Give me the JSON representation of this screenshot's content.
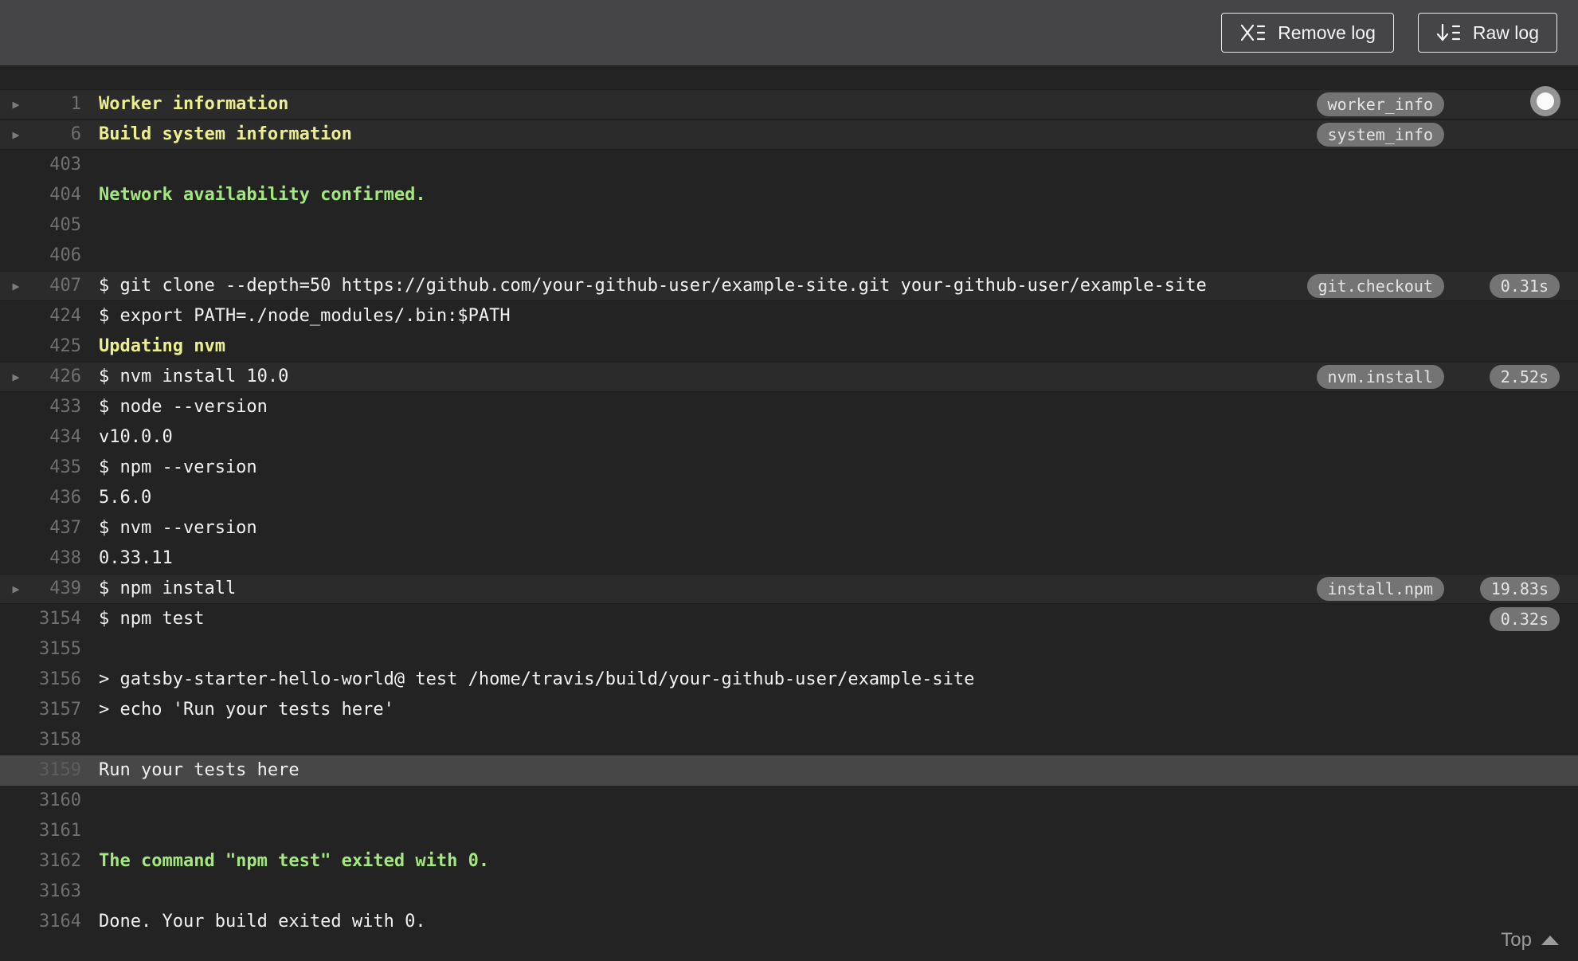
{
  "header": {
    "remove_log_label": "Remove log",
    "raw_log_label": "Raw log",
    "remove_log_icon": "clear-log-list-icon",
    "raw_log_icon": "download-log-list-icon"
  },
  "colors": {
    "header_bg": "#454547",
    "log_bg": "#232323",
    "fold_row_bg": "#2b2b2b",
    "selected_row_bg": "#474747",
    "section_yellow": "#edee8e",
    "success_green": "#a3e87e",
    "pill_bg": "#747474"
  },
  "log": {
    "top_link_label": "Top",
    "rows": [
      {
        "num": "1",
        "text": "Worker information",
        "style": "yellow",
        "fold": true,
        "row": "fold",
        "tag": "worker_info",
        "time": ""
      },
      {
        "num": "6",
        "text": "Build system information",
        "style": "yellow",
        "fold": true,
        "row": "fold",
        "tag": "system_info",
        "time": ""
      },
      {
        "num": "403",
        "text": "",
        "style": "plain",
        "fold": false,
        "row": "",
        "tag": "",
        "time": ""
      },
      {
        "num": "404",
        "text": "Network availability confirmed.",
        "style": "green",
        "fold": false,
        "row": "",
        "tag": "",
        "time": ""
      },
      {
        "num": "405",
        "text": "",
        "style": "plain",
        "fold": false,
        "row": "",
        "tag": "",
        "time": ""
      },
      {
        "num": "406",
        "text": "",
        "style": "plain",
        "fold": false,
        "row": "",
        "tag": "",
        "time": ""
      },
      {
        "num": "407",
        "text": "$ git clone --depth=50 https://github.com/your-github-user/example-site.git your-github-user/example-site",
        "style": "plain",
        "fold": true,
        "row": "fold",
        "tag": "git.checkout",
        "time": "0.31s"
      },
      {
        "num": "424",
        "text": "$ export PATH=./node_modules/.bin:$PATH",
        "style": "plain",
        "fold": false,
        "row": "",
        "tag": "",
        "time": ""
      },
      {
        "num": "425",
        "text": "Updating nvm",
        "style": "yellow",
        "fold": false,
        "row": "",
        "tag": "",
        "time": ""
      },
      {
        "num": "426",
        "text": "$ nvm install 10.0",
        "style": "plain",
        "fold": true,
        "row": "fold",
        "tag": "nvm.install",
        "time": "2.52s"
      },
      {
        "num": "433",
        "text": "$ node --version",
        "style": "plain",
        "fold": false,
        "row": "",
        "tag": "",
        "time": ""
      },
      {
        "num": "434",
        "text": "v10.0.0",
        "style": "plain",
        "fold": false,
        "row": "",
        "tag": "",
        "time": ""
      },
      {
        "num": "435",
        "text": "$ npm --version",
        "style": "plain",
        "fold": false,
        "row": "",
        "tag": "",
        "time": ""
      },
      {
        "num": "436",
        "text": "5.6.0",
        "style": "plain",
        "fold": false,
        "row": "",
        "tag": "",
        "time": ""
      },
      {
        "num": "437",
        "text": "$ nvm --version",
        "style": "plain",
        "fold": false,
        "row": "",
        "tag": "",
        "time": ""
      },
      {
        "num": "438",
        "text": "0.33.11",
        "style": "plain",
        "fold": false,
        "row": "",
        "tag": "",
        "time": ""
      },
      {
        "num": "439",
        "text": "$ npm install",
        "style": "plain",
        "fold": true,
        "row": "fold",
        "tag": "install.npm",
        "time": "19.83s"
      },
      {
        "num": "3154",
        "text": "$ npm test",
        "style": "plain",
        "fold": false,
        "row": "",
        "tag": "",
        "time": "0.32s"
      },
      {
        "num": "3155",
        "text": "",
        "style": "plain",
        "fold": false,
        "row": "",
        "tag": "",
        "time": ""
      },
      {
        "num": "3156",
        "text": "> gatsby-starter-hello-world@ test /home/travis/build/your-github-user/example-site",
        "style": "plain",
        "fold": false,
        "row": "",
        "tag": "",
        "time": ""
      },
      {
        "num": "3157",
        "text": "> echo 'Run your tests here'",
        "style": "plain",
        "fold": false,
        "row": "",
        "tag": "",
        "time": ""
      },
      {
        "num": "3158",
        "text": "",
        "style": "plain",
        "fold": false,
        "row": "",
        "tag": "",
        "time": ""
      },
      {
        "num": "3159",
        "text": "Run your tests here",
        "style": "plain",
        "fold": false,
        "row": "selected",
        "tag": "",
        "time": ""
      },
      {
        "num": "3160",
        "text": "",
        "style": "plain",
        "fold": false,
        "row": "",
        "tag": "",
        "time": ""
      },
      {
        "num": "3161",
        "text": "",
        "style": "plain",
        "fold": false,
        "row": "",
        "tag": "",
        "time": ""
      },
      {
        "num": "3162",
        "text": "The command \"npm test\" exited with 0.",
        "style": "green",
        "fold": false,
        "row": "",
        "tag": "",
        "time": ""
      },
      {
        "num": "3163",
        "text": "",
        "style": "plain",
        "fold": false,
        "row": "",
        "tag": "",
        "time": ""
      },
      {
        "num": "3164",
        "text": "Done. Your build exited with 0.",
        "style": "plain",
        "fold": false,
        "row": "",
        "tag": "",
        "time": ""
      }
    ]
  }
}
